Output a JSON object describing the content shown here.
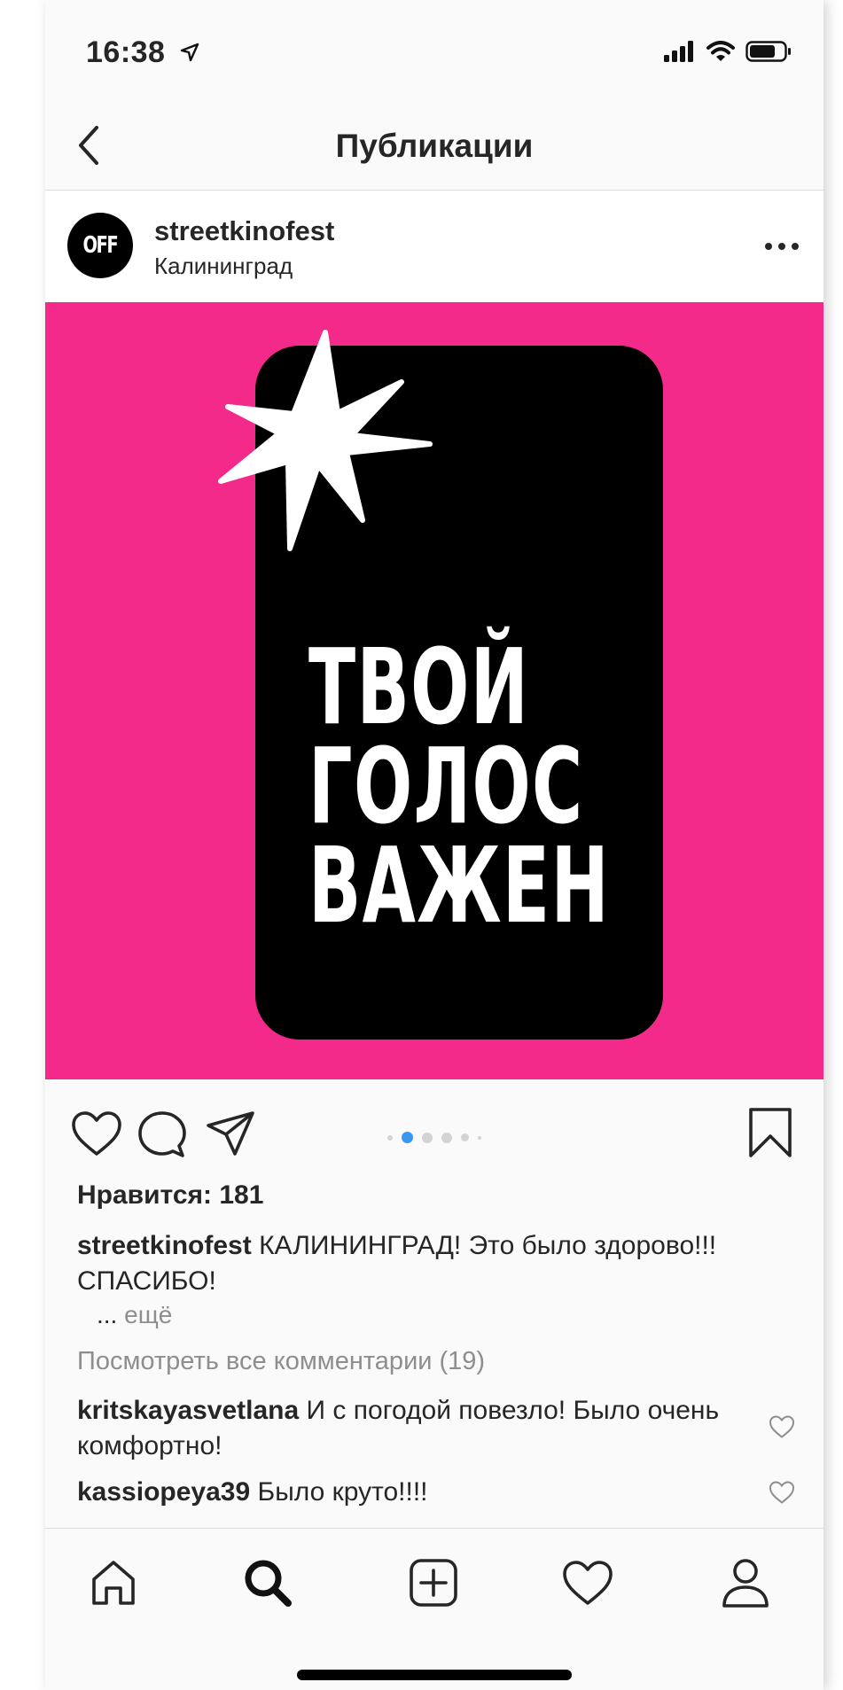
{
  "status_bar": {
    "time": "16:38",
    "icons": [
      "location-arrow-icon",
      "cellular-signal-icon",
      "wifi-icon",
      "battery-icon"
    ]
  },
  "header": {
    "title": "Публикации",
    "back_icon": "chevron-left-icon"
  },
  "post": {
    "avatar_text": "OFF",
    "username": "streetkinofest",
    "location": "Калининград",
    "more_icon": "ellipsis-icon",
    "image": {
      "background_color": "#f42a8a",
      "card_color": "#000000",
      "headline_lines": [
        "ТВОЙ",
        "ГОЛОС",
        "ВАЖЕН"
      ],
      "decoration": "star-burst"
    },
    "actions": {
      "like_icon": "heart-icon",
      "comment_icon": "comment-icon",
      "share_icon": "paper-plane-icon",
      "save_icon": "bookmark-icon"
    },
    "carousel": {
      "total": 6,
      "active_index": 1,
      "active_color": "#3897f0"
    },
    "likes_text": "Нравится: 181",
    "caption": {
      "username": "streetkinofest",
      "text": "КАЛИНИНГРАД! Это было здорово!!! СПАСИБО!"
    },
    "more": {
      "ellipsis": "...",
      "label": "ещё"
    },
    "view_all_comments": "Посмотреть все комментарии (19)",
    "comments": [
      {
        "username": "kritskayasvetlana",
        "text": "И с погодой повезло! Было очень комфортно!"
      },
      {
        "username": "kassiopeya39",
        "text": "Было круто!!!!"
      }
    ]
  },
  "tab_bar": {
    "items": [
      "home-icon",
      "search-icon",
      "add-post-icon",
      "activity-heart-icon",
      "profile-icon"
    ],
    "active": "search-icon"
  }
}
